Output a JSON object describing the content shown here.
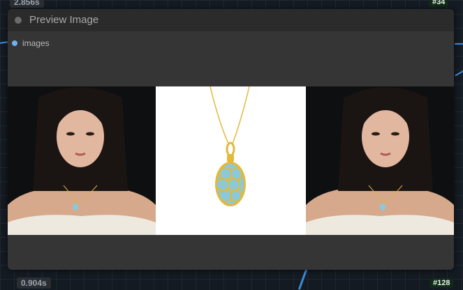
{
  "timings": {
    "top": "2.856s",
    "bottom": "0.904s"
  },
  "node_ids": {
    "top": "#34",
    "bottom": "#128"
  },
  "node": {
    "title": "Preview Image",
    "input_label": "images"
  },
  "images": [
    {
      "alt": "Woman in off-shoulder white top wearing pendant necklace"
    },
    {
      "alt": "Gold chain necklace with blue honeycomb egg pendant"
    },
    {
      "alt": "Woman in off-shoulder white top wearing pendant necklace"
    }
  ],
  "colors": {
    "accent": "#6fb1ef",
    "node_bg": "#353535",
    "header_bg": "#2b2b2b",
    "canvas_bg": "#141a21",
    "enamel": "#8cc9d8",
    "gold": "#e2b93b"
  }
}
